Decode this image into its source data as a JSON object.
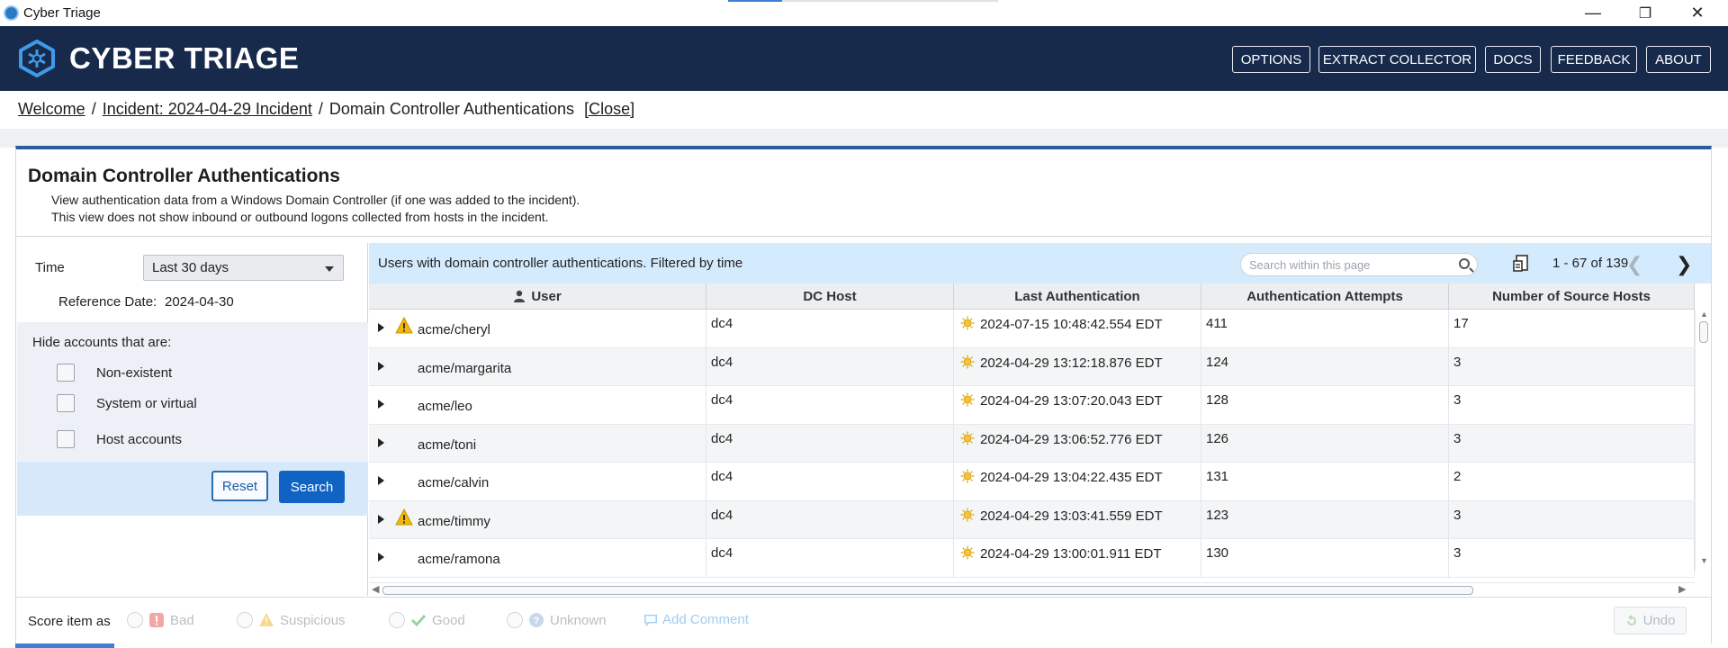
{
  "window": {
    "title": "Cyber Triage",
    "minimize": "—",
    "restore": "❐",
    "close": "✕"
  },
  "header": {
    "brand": "CYBER TRIAGE",
    "buttons": [
      "OPTIONS",
      "EXTRACT COLLECTOR",
      "DOCS",
      "FEEDBACK",
      "ABOUT"
    ]
  },
  "breadcrumb": {
    "items": [
      "Welcome",
      "Incident: 2024-04-29 Incident",
      "Domain Controller Authentications"
    ],
    "separator": "/",
    "close": "[Close]"
  },
  "page": {
    "title": "Domain Controller Authentications",
    "desc1": "View authentication data from a Windows Domain Controller (if one was added to the incident).",
    "desc2": "This view does not show inbound or outbound logons collected from hosts in the incident."
  },
  "filter": {
    "time_label": "Time",
    "time_value": "Last 30 days",
    "ref_label": "Reference Date:",
    "ref_value": "2024-04-30",
    "hide_label": "Hide accounts that are:",
    "options": [
      {
        "label": "Non-existent",
        "checked": false
      },
      {
        "label": "System or virtual",
        "checked": false
      },
      {
        "label": "Host accounts",
        "checked": false
      }
    ],
    "reset": "Reset",
    "search": "Search"
  },
  "table": {
    "caption": "Users with domain controller authentications. Filtered by time",
    "search_placeholder": "Search within this page",
    "page_count": "1 - 67 of 139",
    "columns": [
      "User",
      "DC Host",
      "Last Authentication",
      "Authentication Attempts",
      "Number of Source Hosts"
    ],
    "rows": [
      {
        "user": "acme/cheryl",
        "warn": true,
        "host": "dc4",
        "last": "2024-07-15 10:48:42.554 EDT",
        "attempts": "411",
        "sources": "17"
      },
      {
        "user": "acme/margarita",
        "warn": false,
        "host": "dc4",
        "last": "2024-04-29 13:12:18.876 EDT",
        "attempts": "124",
        "sources": "3"
      },
      {
        "user": "acme/leo",
        "warn": false,
        "host": "dc4",
        "last": "2024-04-29 13:07:20.043 EDT",
        "attempts": "128",
        "sources": "3"
      },
      {
        "user": "acme/toni",
        "warn": false,
        "host": "dc4",
        "last": "2024-04-29 13:06:52.776 EDT",
        "attempts": "126",
        "sources": "3"
      },
      {
        "user": "acme/calvin",
        "warn": false,
        "host": "dc4",
        "last": "2024-04-29 13:04:22.435 EDT",
        "attempts": "131",
        "sources": "2"
      },
      {
        "user": "acme/timmy",
        "warn": true,
        "host": "dc4",
        "last": "2024-04-29 13:03:41.559 EDT",
        "attempts": "123",
        "sources": "3"
      },
      {
        "user": "acme/ramona",
        "warn": false,
        "host": "dc4",
        "last": "2024-04-29 13:00:01.911 EDT",
        "attempts": "130",
        "sources": "3"
      }
    ]
  },
  "scorebar": {
    "label": "Score item as",
    "bad": "Bad",
    "suspicious": "Suspicious",
    "good": "Good",
    "unknown": "Unknown",
    "comment": "Add Comment",
    "undo": "Undo"
  },
  "colors": {
    "header_bg": "#172a4b",
    "accent": "#2c5d9f",
    "primary_button": "#1063c3",
    "table_caption_bg": "#d4eafd"
  },
  "icons": {
    "app": "cyber-triage-logo-icon",
    "search": "search-icon",
    "warn": "warning-icon",
    "time": "sun-icon"
  }
}
